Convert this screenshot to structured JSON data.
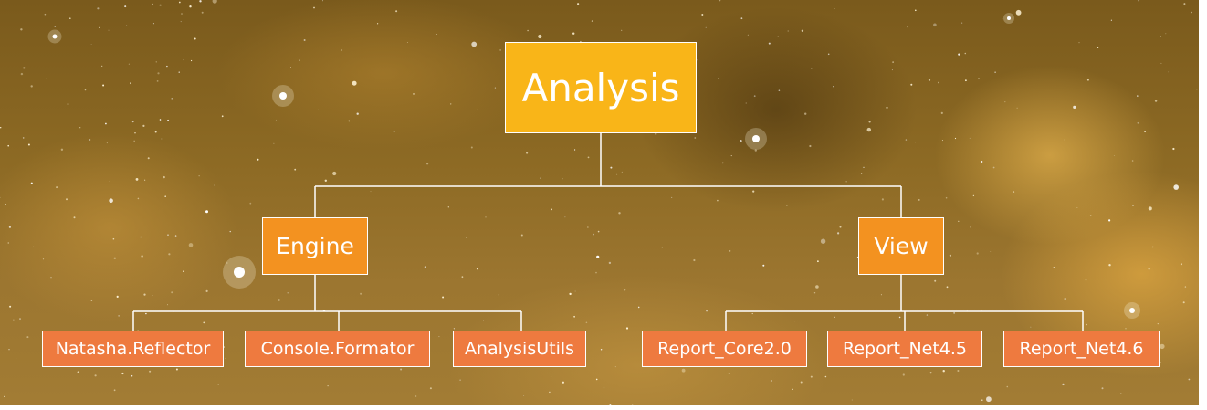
{
  "diagram": {
    "root": {
      "label": "Analysis"
    },
    "branches": [
      {
        "label": "Engine",
        "children": [
          "Natasha.Reflector",
          "Console.Formator",
          "AnalysisUtils"
        ]
      },
      {
        "label": "View",
        "children": [
          "Report_Core2.0",
          "Report_Net4.5",
          "Report_Net4.6"
        ]
      }
    ]
  },
  "colors": {
    "root": "#f9b518",
    "branch": "#f39220",
    "leaf": "#ee7a3f",
    "connector": "#ffffff",
    "background": "#8d6a24"
  }
}
